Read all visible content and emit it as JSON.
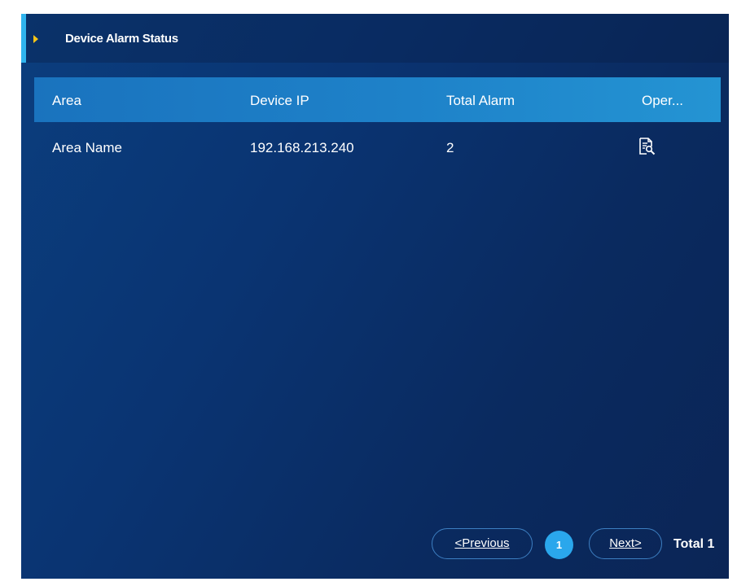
{
  "panel": {
    "title": "Device Alarm Status"
  },
  "table": {
    "columns": [
      "Area",
      "Device IP",
      "Total Alarm",
      "Oper..."
    ],
    "rows": [
      {
        "area": "Area Name",
        "device_ip": "192.168.213.240",
        "total_alarm": "2",
        "operation_icon": "view-details-icon"
      }
    ]
  },
  "pagination": {
    "previous_label": "<Previous",
    "next_label": "Next>",
    "current_page": "1",
    "total_label": "Total 1"
  },
  "colors": {
    "accent": "#2fb4ee",
    "caret": "#f5c518",
    "header_bg": "#1e82c9",
    "active_page": "#2aa7ec"
  }
}
